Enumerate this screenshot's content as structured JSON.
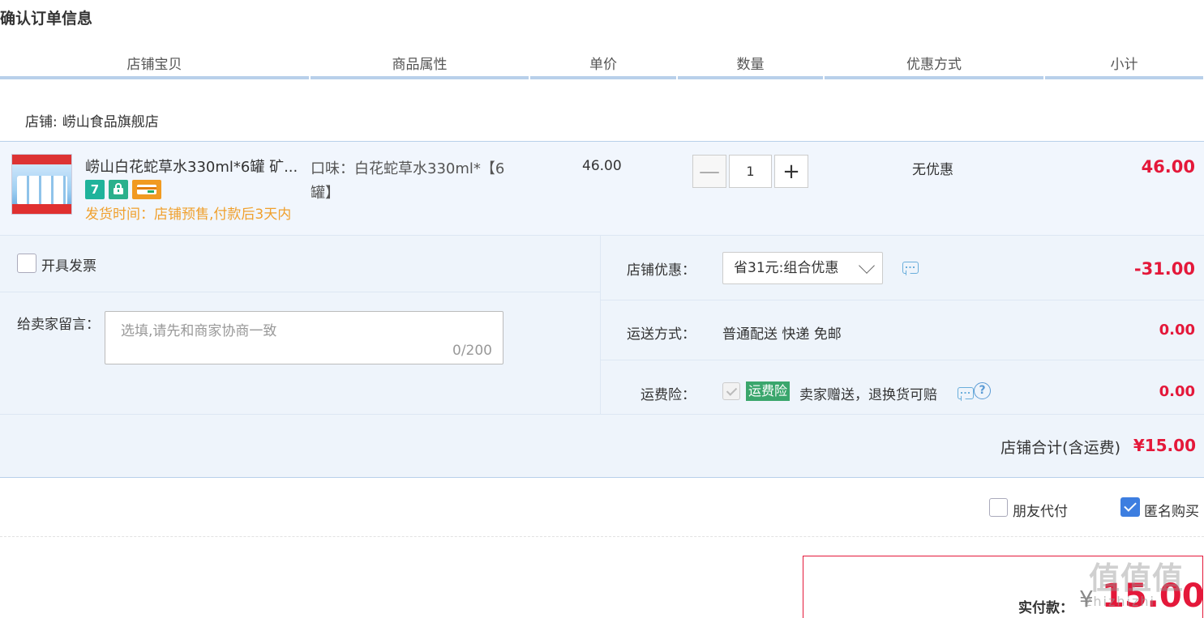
{
  "page": {
    "title": "确认订单信息"
  },
  "columns": [
    "店铺宝贝",
    "商品属性",
    "单价",
    "数量",
    "优惠方式",
    "小计"
  ],
  "shop": {
    "label": "店铺:",
    "name": "崂山食品旗舰店"
  },
  "product": {
    "name": "崂山白花蛇草水330ml*6罐 矿...",
    "badges": [
      {
        "icon": "seven-day-return-icon",
        "text": "7"
      },
      {
        "icon": "guarantee-icon",
        "text": ""
      },
      {
        "icon": "card-payment-icon",
        "text": ""
      }
    ],
    "ship_time": "发货时间：店铺预售,付款后3天内",
    "attribute": "口味：白花蛇草水330ml*【6罐】",
    "unit_price": "46.00",
    "quantity": "1",
    "qty_minus": "—",
    "qty_plus": "+",
    "discount_method": "无优惠",
    "subtotal": "46.00"
  },
  "invoice": {
    "label": "开具发票"
  },
  "message": {
    "label": "给卖家留言：",
    "placeholder": "选填,请先和商家协商一致",
    "counter": "0/200"
  },
  "coupon": {
    "label": "店铺优惠：",
    "selected": "省31元:组合优惠",
    "amount": "-31.00"
  },
  "shipping": {
    "label": "运送方式：",
    "value": "普通配送 快递 免邮",
    "amount": "0.00"
  },
  "insurance": {
    "label": "运费险：",
    "tag": "运费险",
    "text": "卖家赠送，退换货可赔",
    "help": "?",
    "amount": "0.00"
  },
  "shop_total": {
    "label": "店铺合计(含运费)",
    "value": "¥15.00"
  },
  "pay_options": {
    "friend_pay": "朋友代付",
    "anonymous": "匿名购买"
  },
  "payment": {
    "label": "实付款：",
    "currency": "¥",
    "value": "15.00"
  },
  "watermark": {
    "main": "值值值",
    "sub": "zhizhizhi"
  },
  "colors": {
    "accent_red": "#e4183a",
    "header_line": "#b8d0ea",
    "row_bg": "#f1f6fd",
    "ship_time": "#f0a02d",
    "insurance_tag": "#3aa66c",
    "checkbox_checked": "#3d7ee0"
  }
}
